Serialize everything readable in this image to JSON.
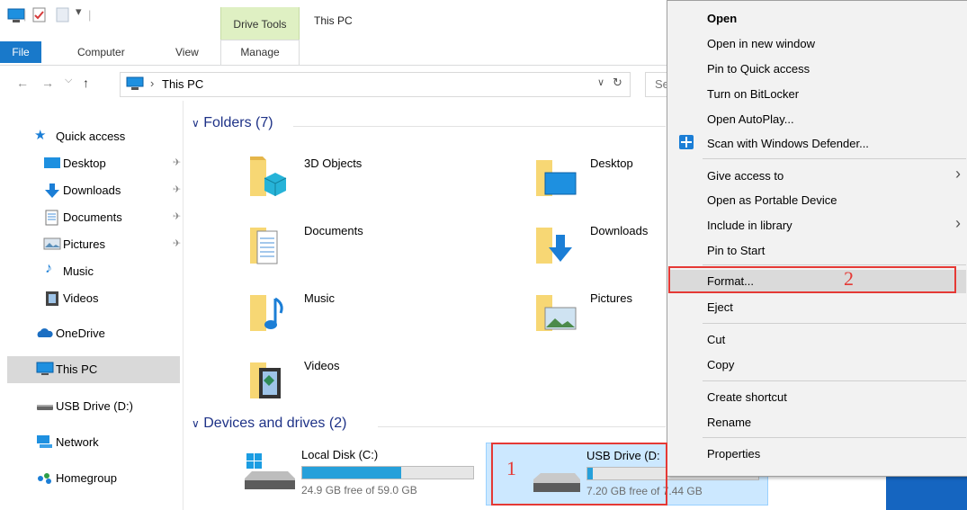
{
  "ribbon": {
    "contextual_group": "Drive Tools",
    "window_title": "This PC",
    "tabs": [
      "File",
      "Computer",
      "View",
      "Manage"
    ]
  },
  "address": {
    "path": "This PC",
    "search_placeholder": "Se"
  },
  "sidebar": {
    "items": [
      {
        "label": "Quick access",
        "pinned": false
      },
      {
        "label": "Desktop",
        "pinned": true
      },
      {
        "label": "Downloads",
        "pinned": true
      },
      {
        "label": "Documents",
        "pinned": true
      },
      {
        "label": "Pictures",
        "pinned": true
      },
      {
        "label": "Music",
        "pinned": false
      },
      {
        "label": "Videos",
        "pinned": false
      },
      {
        "label": "OneDrive",
        "pinned": false
      },
      {
        "label": "This PC",
        "pinned": false,
        "selected": true
      },
      {
        "label": "USB Drive (D:)",
        "pinned": false
      },
      {
        "label": "Network",
        "pinned": false
      },
      {
        "label": "Homegroup",
        "pinned": false
      }
    ]
  },
  "main": {
    "folders_header": "Folders (7)",
    "folders": [
      "3D Objects",
      "Desktop",
      "Documents",
      "Downloads",
      "Music",
      "Pictures",
      "Videos"
    ],
    "devices_header": "Devices and drives (2)",
    "drives": [
      {
        "name": "Local Disk (C:)",
        "free": "24.9 GB free of 59.0 GB",
        "used_fraction": 0.58
      },
      {
        "name": "USB Drive (D:",
        "free": "7.20 GB free of 7.44 GB",
        "used_fraction": 0.03
      }
    ]
  },
  "context_menu": {
    "items": [
      "Open",
      "Open in new window",
      "Pin to Quick access",
      "Turn on BitLocker",
      "Open AutoPlay...",
      "Scan with Windows Defender...",
      "Give access to",
      "Open as Portable Device",
      "Include in library",
      "Pin to Start",
      "Format...",
      "Eject",
      "Cut",
      "Copy",
      "Create shortcut",
      "Rename",
      "Properties"
    ]
  },
  "annotations": {
    "first": "1",
    "second": "2"
  },
  "colors": {
    "accent": "#1979ca",
    "annotation": "#e53935",
    "selection": "#cce8ff"
  }
}
